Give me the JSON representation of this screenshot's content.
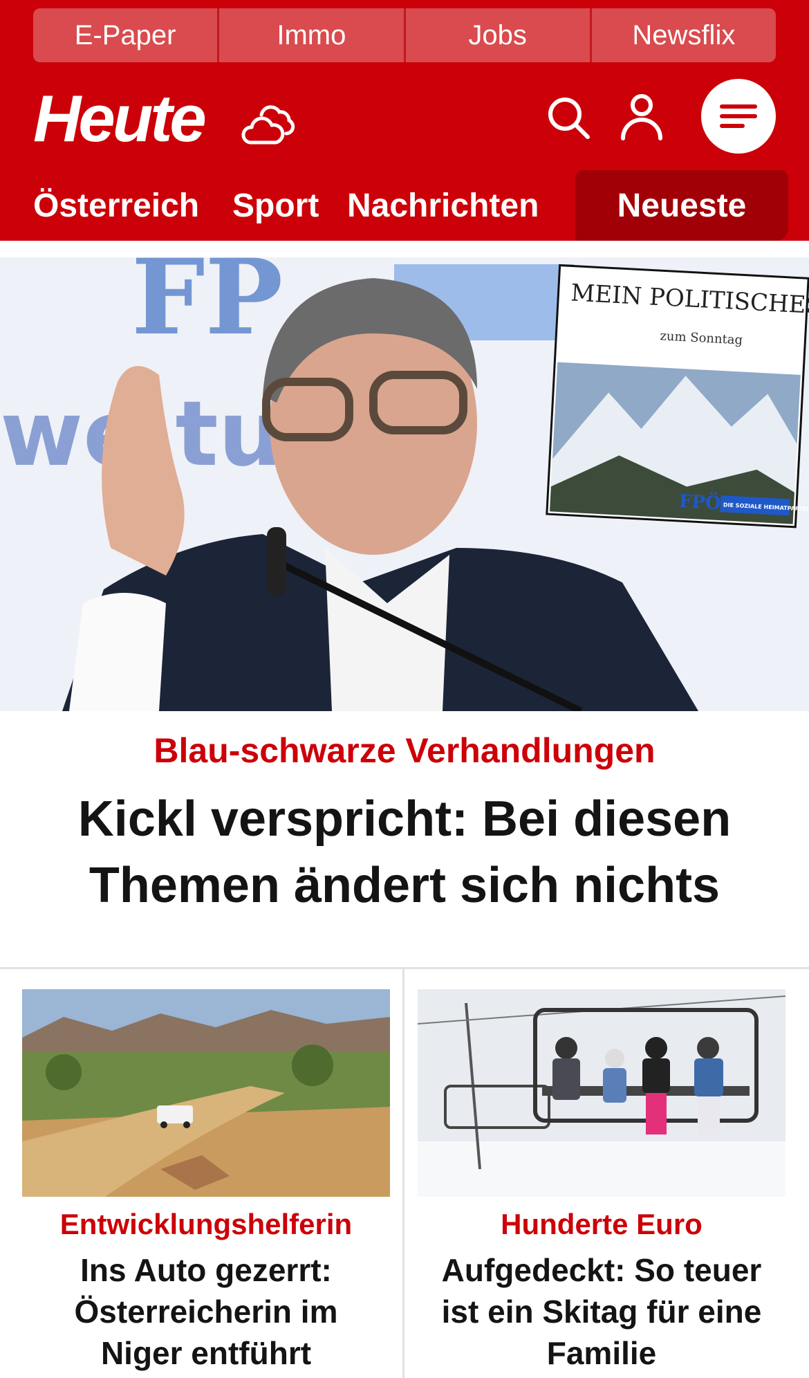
{
  "topnav": [
    "E-Paper",
    "Immo",
    "Jobs",
    "Newsflix"
  ],
  "brand": {
    "logo": "Heute"
  },
  "icons": {
    "weather": "cloud-weather-icon",
    "search": "search-icon",
    "account": "user-icon",
    "menu": "menu-icon"
  },
  "sections": [
    "Österreich",
    "Sport",
    "Nachrichten",
    "Neueste"
  ],
  "colors": {
    "brand_red": "#cc0008",
    "tab_active": "#a10007",
    "topnav_bg": "#d94b4e"
  },
  "hero": {
    "kicker": "Blau-schwarze Verhandlungen",
    "headline": "Kickl verspricht: Bei diesen Themen ändert sich nichts",
    "inset_title": "MEIN POLITISCHES WORT",
    "inset_subtitle": "zum Sonntag",
    "inset_logo": "FPÖ",
    "inset_tag": "DIE SOZIALE HEIMATPARTEI"
  },
  "cards": [
    {
      "kicker": "Entwicklungshelferin",
      "headline": "Ins Auto gezerrt: Österreicherin im Niger entführt"
    },
    {
      "kicker": "Hunderte Euro",
      "headline": "Aufgedeckt: So teuer ist ein Skitag für eine Familie"
    }
  ]
}
